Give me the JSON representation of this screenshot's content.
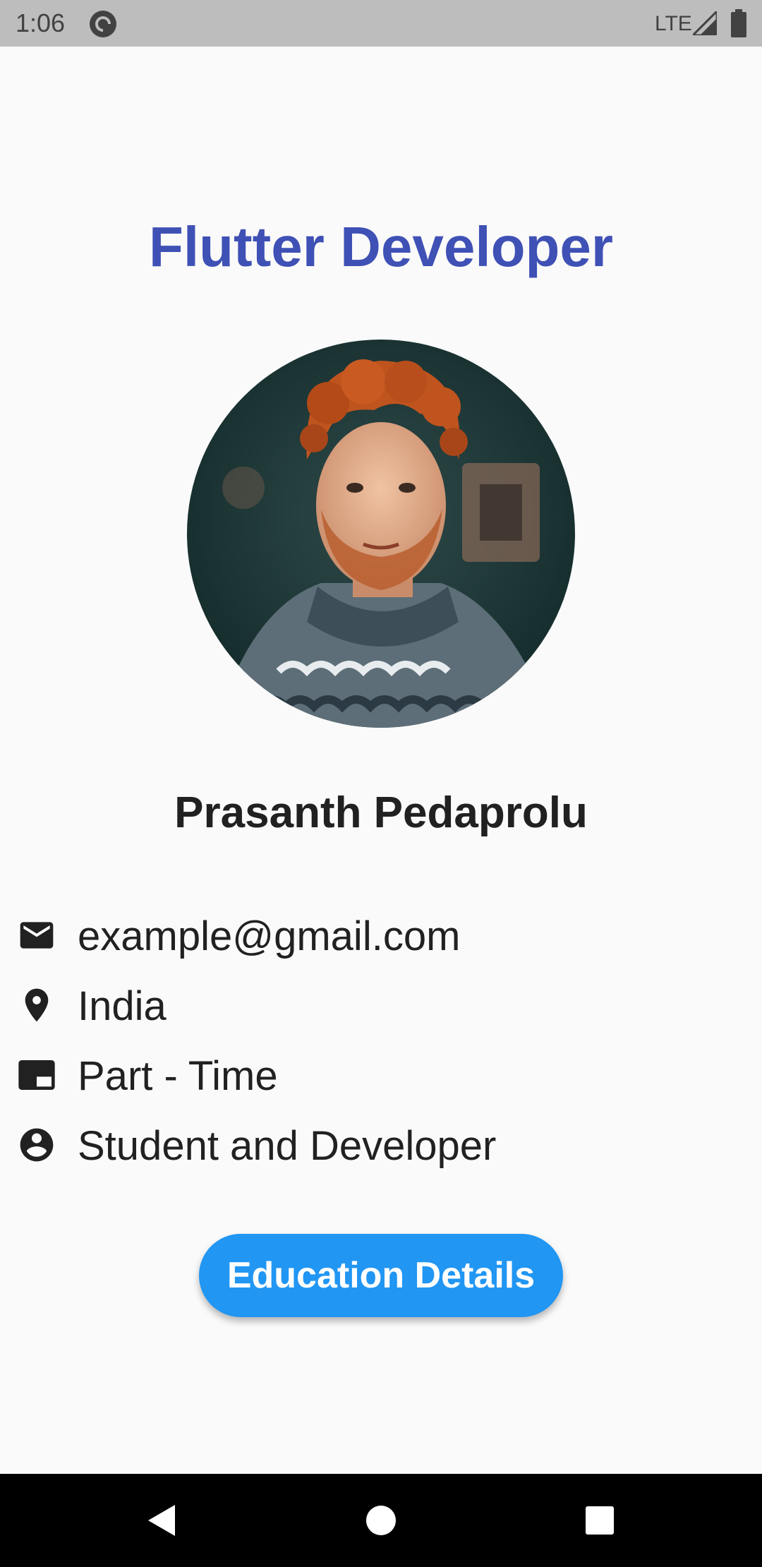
{
  "status_bar": {
    "time": "1:06",
    "network": "LTE",
    "app_icon": "pocket-casts-icon",
    "signal_icon": "signal-icon",
    "battery_icon": "battery-icon"
  },
  "profile": {
    "title": "Flutter Developer",
    "name": "Prasanth Pedaprolu",
    "avatar": "profile-photo"
  },
  "info": [
    {
      "icon": "email-icon",
      "text": "example@gmail.com"
    },
    {
      "icon": "location-icon",
      "text": "India"
    },
    {
      "icon": "work-type-icon",
      "text": "Part - Time"
    },
    {
      "icon": "account-icon",
      "text": "Student and Developer"
    }
  ],
  "actions": {
    "education_label": "Education Details"
  },
  "nav_bar": {
    "back_icon": "back-icon",
    "home_icon": "home-icon",
    "recents_icon": "recents-icon"
  },
  "colors": {
    "title": "#3f51b5",
    "button": "#2196f3",
    "text": "#212121",
    "status_bar": "#bdbdbd",
    "background": "#fafafa"
  }
}
